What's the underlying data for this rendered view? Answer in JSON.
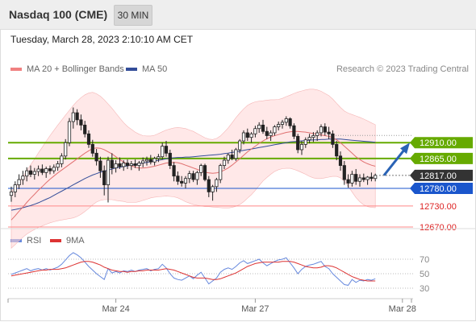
{
  "header": {
    "title": "Nasdaq 100 (CME)",
    "interval": "30 MIN",
    "timestamp": "Tuesday, March 28, 2023 2:10:10 AM CET"
  },
  "legend": {
    "ma20": "MA 20 + Bollinger Bands",
    "ma50": "MA 50",
    "copyright": "Research © 2023 Trading Central",
    "rsi": "RSI",
    "ma9": "9MA"
  },
  "colors": {
    "resistance": "#66aa00",
    "pivot": "#333333",
    "support": "#1a56cc",
    "support_minor": "#ff8888",
    "bollinger": "#ffd5d5",
    "ma20": "#e07070",
    "ma50": "#334d99",
    "rsi": "#6688dd",
    "ma9": "#dd3333",
    "arrow": "#2a63b5"
  },
  "chart_data": [
    {
      "type": "candlestick",
      "ylim": [
        12640,
        13060
      ],
      "x_ticks": [
        {
          "label": "Mar 24",
          "index": 27
        },
        {
          "label": "Mar 27",
          "index": 63
        },
        {
          "label": "Mar 28",
          "index": 101
        }
      ],
      "levels": [
        {
          "value": 12910.0,
          "label": "12910.00",
          "kind": "resistance"
        },
        {
          "value": 12865.0,
          "label": "12865.00",
          "kind": "resistance"
        },
        {
          "value": 12817.0,
          "label": "12817.00",
          "kind": "pivot"
        },
        {
          "value": 12780.0,
          "label": "12780.00",
          "kind": "support"
        },
        {
          "value": 12730.0,
          "label": "12730.00",
          "kind": "support_minor"
        },
        {
          "value": 12670.0,
          "label": "12670.00",
          "kind": "support_minor"
        }
      ],
      "forecast": {
        "from": 12817,
        "to": 12910
      },
      "ohlc": [
        [
          12760,
          12785,
          12742,
          12770
        ],
        [
          12770,
          12800,
          12755,
          12790
        ],
        [
          12790,
          12820,
          12778,
          12805
        ],
        [
          12805,
          12830,
          12790,
          12815
        ],
        [
          12815,
          12840,
          12800,
          12830
        ],
        [
          12830,
          12845,
          12812,
          12820
        ],
        [
          12820,
          12838,
          12805,
          12828
        ],
        [
          12828,
          12845,
          12815,
          12835
        ],
        [
          12835,
          12848,
          12818,
          12825
        ],
        [
          12825,
          12842,
          12810,
          12836
        ],
        [
          12836,
          12845,
          12820,
          12830
        ],
        [
          12830,
          12848,
          12822,
          12840
        ],
        [
          12840,
          12858,
          12830,
          12850
        ],
        [
          12850,
          12880,
          12840,
          12872
        ],
        [
          12872,
          12920,
          12862,
          12910
        ],
        [
          12910,
          12980,
          12900,
          12970
        ],
        [
          12970,
          13010,
          12950,
          12995
        ],
        [
          12995,
          13005,
          12960,
          12975
        ],
        [
          12975,
          12990,
          12945,
          12960
        ],
        [
          12960,
          12972,
          12925,
          12935
        ],
        [
          12935,
          12945,
          12895,
          12905
        ],
        [
          12905,
          12918,
          12870,
          12880
        ],
        [
          12880,
          12892,
          12845,
          12858
        ],
        [
          12858,
          12870,
          12810,
          12830
        ],
        [
          12830,
          12845,
          12760,
          12790
        ],
        [
          12790,
          12870,
          12740,
          12860
        ],
        [
          12860,
          12880,
          12820,
          12838
        ],
        [
          12838,
          12860,
          12825,
          12850
        ],
        [
          12850,
          12868,
          12835,
          12842
        ],
        [
          12842,
          12860,
          12830,
          12852
        ],
        [
          12852,
          12862,
          12835,
          12845
        ],
        [
          12845,
          12858,
          12832,
          12850
        ],
        [
          12850,
          12862,
          12838,
          12845
        ],
        [
          12845,
          12858,
          12830,
          12852
        ],
        [
          12852,
          12868,
          12840,
          12858
        ],
        [
          12858,
          12870,
          12845,
          12862
        ],
        [
          12862,
          12875,
          12848,
          12855
        ],
        [
          12855,
          12870,
          12845,
          12865
        ],
        [
          12865,
          12878,
          12855,
          12870
        ],
        [
          12870,
          12910,
          12862,
          12900
        ],
        [
          12900,
          12915,
          12870,
          12880
        ],
        [
          12880,
          12890,
          12835,
          12845
        ],
        [
          12845,
          12855,
          12800,
          12815
        ],
        [
          12815,
          12828,
          12790,
          12800
        ],
        [
          12800,
          12815,
          12785,
          12795
        ],
        [
          12795,
          12815,
          12780,
          12808
        ],
        [
          12808,
          12830,
          12795,
          12822
        ],
        [
          12822,
          12830,
          12798,
          12805
        ],
        [
          12805,
          12830,
          12790,
          12825
        ],
        [
          12825,
          12850,
          12815,
          12845
        ],
        [
          12845,
          12850,
          12800,
          12805
        ],
        [
          12805,
          12815,
          12755,
          12770
        ],
        [
          12770,
          12790,
          12745,
          12785
        ],
        [
          12785,
          12810,
          12770,
          12805
        ],
        [
          12805,
          12850,
          12795,
          12845
        ],
        [
          12845,
          12870,
          12835,
          12860
        ],
        [
          12860,
          12880,
          12850,
          12875
        ],
        [
          12875,
          12890,
          12860,
          12865
        ],
        [
          12865,
          12895,
          12858,
          12890
        ],
        [
          12890,
          12920,
          12880,
          12915
        ],
        [
          12915,
          12945,
          12905,
          12938
        ],
        [
          12938,
          12950,
          12915,
          12925
        ],
        [
          12925,
          12940,
          12910,
          12935
        ],
        [
          12935,
          12958,
          12925,
          12950
        ],
        [
          12950,
          12968,
          12938,
          12960
        ],
        [
          12960,
          12975,
          12935,
          12942
        ],
        [
          12942,
          12955,
          12920,
          12930
        ],
        [
          12930,
          12945,
          12915,
          12938
        ],
        [
          12938,
          12960,
          12930,
          12955
        ],
        [
          12955,
          12970,
          12945,
          12962
        ],
        [
          12962,
          12975,
          12950,
          12968
        ],
        [
          12968,
          12985,
          12958,
          12978
        ],
        [
          12978,
          12982,
          12950,
          12958
        ],
        [
          12958,
          12965,
          12920,
          12928
        ],
        [
          12928,
          12935,
          12880,
          12890
        ],
        [
          12890,
          12915,
          12875,
          12905
        ],
        [
          12905,
          12925,
          12895,
          12918
        ],
        [
          12918,
          12935,
          12908,
          12925
        ],
        [
          12925,
          12940,
          12912,
          12930
        ],
        [
          12930,
          12945,
          12915,
          12938
        ],
        [
          12938,
          12962,
          12928,
          12955
        ],
        [
          12955,
          12965,
          12930,
          12940
        ],
        [
          12940,
          12955,
          12920,
          12935
        ],
        [
          12935,
          12945,
          12895,
          12905
        ],
        [
          12905,
          12915,
          12860,
          12872
        ],
        [
          12872,
          12885,
          12830,
          12845
        ],
        [
          12845,
          12858,
          12790,
          12805
        ],
        [
          12805,
          12820,
          12782,
          12795
        ],
        [
          12795,
          12830,
          12785,
          12820
        ],
        [
          12820,
          12835,
          12790,
          12800
        ],
        [
          12800,
          12820,
          12785,
          12810
        ],
        [
          12810,
          12822,
          12798,
          12805
        ],
        [
          12805,
          12815,
          12790,
          12812
        ],
        [
          12812,
          12825,
          12800,
          12808
        ],
        [
          12808,
          12822,
          12800,
          12817
        ]
      ],
      "ma20": [
        12690,
        12702,
        12715,
        12727,
        12740,
        12752,
        12763,
        12775,
        12785,
        12796,
        12806,
        12815,
        12824,
        12832,
        12840,
        12848,
        12856,
        12864,
        12872,
        12880,
        12887,
        12893,
        12895,
        12894,
        12890,
        12884,
        12878,
        12870,
        12862,
        12855,
        12848,
        12844,
        12840,
        12838,
        12838,
        12839,
        12841,
        12843,
        12846,
        12849,
        12852,
        12853,
        12854,
        12853,
        12850,
        12846,
        12842,
        12838,
        12834,
        12830,
        12826,
        12824,
        12823,
        12824,
        12827,
        12832,
        12838,
        12846,
        12855,
        12864,
        12874,
        12884,
        12892,
        12900,
        12908,
        12915,
        12921,
        12926,
        12930,
        12933,
        12936,
        12939,
        12941,
        12942,
        12942,
        12941,
        12940,
        12938,
        12936,
        12934,
        12932,
        12930,
        12928,
        12924,
        12918,
        12910,
        12900,
        12890,
        12880,
        12870,
        12862,
        12855,
        12850,
        12846,
        12843
      ],
      "ma50": [
        12718,
        12720,
        12722,
        12725,
        12728,
        12731,
        12735,
        12739,
        12744,
        12749,
        12754,
        12760,
        12766,
        12772,
        12778,
        12784,
        12790,
        12796,
        12802,
        12808,
        12813,
        12818,
        12822,
        12826,
        12829,
        12832,
        12835,
        12838,
        12840,
        12842,
        12844,
        12846,
        12848,
        12850,
        12852,
        12854,
        12856,
        12858,
        12860,
        12862,
        12864,
        12866,
        12867,
        12868,
        12868,
        12869,
        12869,
        12870,
        12871,
        12872,
        12873,
        12874,
        12875,
        12876,
        12877,
        12879,
        12880,
        12882,
        12884,
        12886,
        12888,
        12890,
        12892,
        12894,
        12896,
        12898,
        12900,
        12902,
        12904,
        12906,
        12908,
        12910,
        12912,
        12913,
        12914,
        12915,
        12916,
        12917,
        12918,
        12918,
        12919,
        12919,
        12920,
        12920,
        12920,
        12920,
        12919,
        12918,
        12917,
        12916,
        12915,
        12914,
        12913,
        12912,
        12911
      ],
      "bb_width": [
        80,
        82,
        84,
        86,
        90,
        95,
        100,
        106,
        112,
        118,
        124,
        130,
        136,
        142,
        148,
        154,
        160,
        164,
        166,
        166,
        164,
        160,
        154,
        148,
        142,
        136,
        130,
        124,
        118,
        112,
        108,
        104,
        100,
        96,
        92,
        90,
        88,
        88,
        90,
        92,
        94,
        96,
        98,
        100,
        102,
        104,
        104,
        104,
        102,
        100,
        98,
        96,
        96,
        98,
        102,
        108,
        114,
        120,
        126,
        130,
        132,
        132,
        130,
        126,
        120,
        114,
        110,
        106,
        102,
        100,
        100,
        102,
        104,
        108,
        112,
        116,
        120,
        124,
        126,
        126,
        124,
        120,
        116,
        110,
        104,
        100,
        100,
        104,
        110,
        116,
        120,
        122,
        122,
        120,
        118
      ]
    },
    {
      "type": "line",
      "name": "RSI",
      "ylim": [
        10,
        90
      ],
      "y_ticks": [
        70,
        50,
        30
      ],
      "rsi": [
        49,
        51,
        53,
        55,
        57,
        54,
        56,
        57,
        55,
        57,
        55,
        57,
        59,
        63,
        69,
        75,
        79,
        76,
        72,
        66,
        60,
        55,
        50,
        46,
        42,
        57,
        51,
        53,
        51,
        54,
        53,
        55,
        53,
        55,
        56,
        57,
        54,
        56,
        57,
        63,
        58,
        50,
        44,
        42,
        41,
        44,
        47,
        43,
        48,
        52,
        44,
        36,
        40,
        44,
        52,
        56,
        58,
        56,
        60,
        65,
        68,
        64,
        66,
        68,
        70,
        65,
        61,
        64,
        67,
        69,
        70,
        72,
        65,
        58,
        50,
        56,
        60,
        62,
        63,
        65,
        67,
        60,
        57,
        50,
        45,
        40,
        35,
        34,
        42,
        38,
        41,
        40,
        42,
        41,
        43
      ],
      "ma9": [
        47,
        48,
        49,
        50,
        51,
        52,
        53,
        54,
        55,
        55,
        56,
        56,
        56,
        57,
        58,
        60,
        62,
        64,
        66,
        67,
        67,
        66,
        64,
        62,
        59,
        57,
        55,
        54,
        53,
        53,
        52,
        53,
        53,
        54,
        54,
        55,
        55,
        55,
        55,
        56,
        57,
        56,
        55,
        53,
        51,
        49,
        47,
        45,
        44,
        44,
        44,
        43,
        42,
        42,
        43,
        45,
        47,
        49,
        51,
        54,
        57,
        60,
        62,
        64,
        65,
        66,
        66,
        66,
        66,
        66,
        67,
        67,
        67,
        66,
        64,
        62,
        60,
        59,
        58,
        58,
        59,
        61,
        61,
        60,
        58,
        55,
        52,
        49,
        46,
        44,
        42,
        41,
        40,
        40,
        40
      ]
    }
  ]
}
